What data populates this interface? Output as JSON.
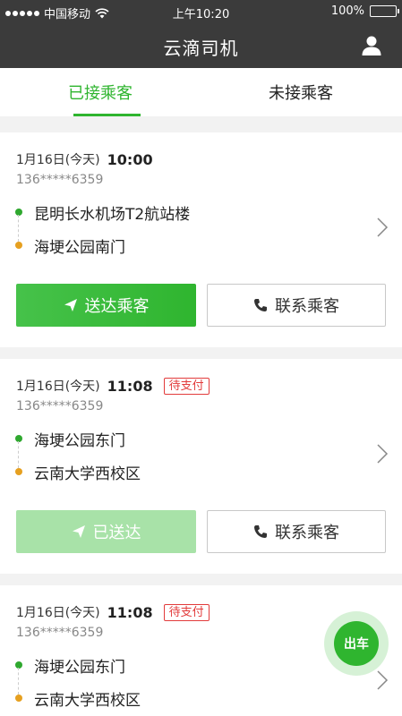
{
  "status_bar": {
    "carrier": "中国移动",
    "time": "上午10:20",
    "battery": "100%"
  },
  "nav": {
    "title": "云滴司机"
  },
  "tabs": [
    {
      "label": "已接乘客"
    },
    {
      "label": "未接乘客"
    }
  ],
  "orders": [
    {
      "date": "1月16日(今天)",
      "time": "10:00",
      "badge": "",
      "phone": "136*****6359",
      "from": "昆明长水机场T2航站楼",
      "to": "海埂公园南门",
      "action_label": "送达乘客",
      "contact_label": "联系乘客"
    },
    {
      "date": "1月16日(今天)",
      "time": "11:08",
      "badge": "待支付",
      "phone": "136*****6359",
      "from": "海埂公园东门",
      "to": "云南大学西校区",
      "action_label": "已送达",
      "contact_label": "联系乘客"
    },
    {
      "date": "1月16日(今天)",
      "time": "11:08",
      "badge": "待支付",
      "phone": "136*****6359",
      "from": "海埂公园东门",
      "to": "云南大学西校区"
    }
  ],
  "fab": {
    "label": "出车"
  },
  "colors": {
    "accent": "#2fb52f",
    "nav_bg": "#3b3b3b",
    "badge": "#e23b3b",
    "start_dot": "#2fa82f",
    "end_dot": "#e6a020"
  }
}
